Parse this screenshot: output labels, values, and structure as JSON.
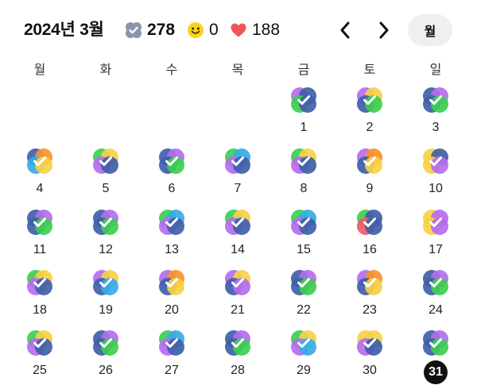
{
  "header": {
    "title": "2024년 3월",
    "check_count": "278",
    "smile_count": "0",
    "heart_count": "188",
    "prev_label": "‹",
    "next_label": "›",
    "view_mode_label": "월"
  },
  "weekdays": [
    "월",
    "화",
    "수",
    "목",
    "금",
    "토",
    "일"
  ],
  "colors": {
    "blue": "#3f5fa8",
    "purple": "#b56cf0",
    "green": "#3ccf4e",
    "yellow": "#f8d047",
    "orange": "#f7942a",
    "skyblue": "#35ace6",
    "red": "#ef5a6a",
    "heart": "#f2545b",
    "check_badge": "#8895ad",
    "smile": "#f7d221"
  },
  "days": [
    {
      "day": "1",
      "col": 4,
      "row": 0,
      "petals": [
        "purple",
        "blue",
        "green",
        "blue"
      ]
    },
    {
      "day": "2",
      "col": 5,
      "row": 0,
      "petals": [
        "purple",
        "yellow",
        "blue",
        "green"
      ]
    },
    {
      "day": "3",
      "col": 6,
      "row": 0,
      "petals": [
        "blue",
        "purple",
        "blue",
        "green"
      ]
    },
    {
      "day": "4",
      "col": 0,
      "row": 1,
      "petals": [
        "blue",
        "orange",
        "skyblue",
        "yellow"
      ]
    },
    {
      "day": "5",
      "col": 1,
      "row": 1,
      "petals": [
        "green",
        "yellow",
        "purple",
        "blue"
      ]
    },
    {
      "day": "6",
      "col": 2,
      "row": 1,
      "petals": [
        "blue",
        "purple",
        "blue",
        "green"
      ]
    },
    {
      "day": "7",
      "col": 3,
      "row": 1,
      "petals": [
        "green",
        "skyblue",
        "purple",
        "blue"
      ]
    },
    {
      "day": "8",
      "col": 4,
      "row": 1,
      "petals": [
        "green",
        "yellow",
        "purple",
        "blue"
      ]
    },
    {
      "day": "9",
      "col": 5,
      "row": 1,
      "petals": [
        "purple",
        "orange",
        "blue",
        "yellow"
      ]
    },
    {
      "day": "10",
      "col": 6,
      "row": 1,
      "petals": [
        "yellow",
        "blue",
        "yellow",
        "purple"
      ]
    },
    {
      "day": "11",
      "col": 0,
      "row": 2,
      "petals": [
        "blue",
        "purple",
        "blue",
        "green"
      ]
    },
    {
      "day": "12",
      "col": 1,
      "row": 2,
      "petals": [
        "blue",
        "purple",
        "blue",
        "green"
      ]
    },
    {
      "day": "13",
      "col": 2,
      "row": 2,
      "petals": [
        "green",
        "skyblue",
        "purple",
        "blue"
      ]
    },
    {
      "day": "14",
      "col": 3,
      "row": 2,
      "petals": [
        "green",
        "yellow",
        "purple",
        "blue"
      ]
    },
    {
      "day": "15",
      "col": 4,
      "row": 2,
      "petals": [
        "green",
        "skyblue",
        "purple",
        "blue"
      ]
    },
    {
      "day": "16",
      "col": 5,
      "row": 2,
      "petals": [
        "green",
        "blue",
        "red",
        "blue"
      ]
    },
    {
      "day": "17",
      "col": 6,
      "row": 2,
      "petals": [
        "yellow",
        "purple",
        "yellow",
        "purple"
      ]
    },
    {
      "day": "18",
      "col": 0,
      "row": 3,
      "petals": [
        "green",
        "yellow",
        "purple",
        "blue"
      ]
    },
    {
      "day": "19",
      "col": 1,
      "row": 3,
      "petals": [
        "purple",
        "yellow",
        "blue",
        "skyblue"
      ]
    },
    {
      "day": "20",
      "col": 2,
      "row": 3,
      "petals": [
        "purple",
        "orange",
        "blue",
        "yellow"
      ]
    },
    {
      "day": "21",
      "col": 3,
      "row": 3,
      "petals": [
        "purple",
        "yellow",
        "blue",
        "purple"
      ]
    },
    {
      "day": "22",
      "col": 4,
      "row": 3,
      "petals": [
        "blue",
        "purple",
        "blue",
        "green"
      ]
    },
    {
      "day": "23",
      "col": 5,
      "row": 3,
      "petals": [
        "purple",
        "orange",
        "blue",
        "yellow"
      ]
    },
    {
      "day": "24",
      "col": 6,
      "row": 3,
      "petals": [
        "blue",
        "purple",
        "blue",
        "green"
      ]
    },
    {
      "day": "25",
      "col": 0,
      "row": 4,
      "petals": [
        "green",
        "yellow",
        "purple",
        "blue"
      ]
    },
    {
      "day": "26",
      "col": 1,
      "row": 4,
      "petals": [
        "blue",
        "purple",
        "blue",
        "green"
      ]
    },
    {
      "day": "27",
      "col": 2,
      "row": 4,
      "petals": [
        "green",
        "skyblue",
        "purple",
        "blue"
      ]
    },
    {
      "day": "28",
      "col": 3,
      "row": 4,
      "petals": [
        "blue",
        "purple",
        "blue",
        "green"
      ]
    },
    {
      "day": "29",
      "col": 4,
      "row": 4,
      "petals": [
        "green",
        "yellow",
        "purple",
        "skyblue"
      ]
    },
    {
      "day": "30",
      "col": 5,
      "row": 4,
      "petals": [
        "yellow",
        "yellow",
        "purple",
        "blue"
      ]
    },
    {
      "day": "31",
      "col": 6,
      "row": 4,
      "petals": [
        "blue",
        "purple",
        "blue",
        "green"
      ],
      "today": true
    }
  ]
}
